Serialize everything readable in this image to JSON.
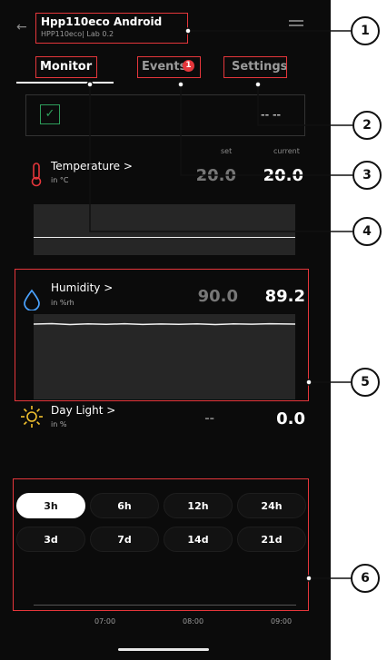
{
  "header": {
    "title": "Hpp110eco Android",
    "subtitle": "HPP110eco| Lab 0.2"
  },
  "tabs": {
    "monitor": "Monitor",
    "events": "Events",
    "events_badge": "1",
    "settings": "Settings"
  },
  "status": {
    "right_value": "-- --"
  },
  "columns": {
    "set": "set",
    "current": "current"
  },
  "temperature": {
    "label": "Temperature >",
    "unit": "in °C",
    "set": "20.0",
    "current": "20.0"
  },
  "humidity": {
    "label": "Humidity >",
    "unit": "in %rh",
    "set": "90.0",
    "current": "89.2"
  },
  "daylight": {
    "label": "Day Light >",
    "unit": "in %",
    "set": "--",
    "current": "0.0"
  },
  "ranges": [
    "3h",
    "6h",
    "12h",
    "24h",
    "3d",
    "7d",
    "14d",
    "21d"
  ],
  "selected_range": "3h",
  "time_axis": [
    "07:00",
    "08:00",
    "09:00"
  ],
  "callouts": [
    "1",
    "2",
    "3",
    "4",
    "5",
    "6"
  ],
  "colors": {
    "accent_red": "#e5363b",
    "check_green": "#2e9e5b",
    "icon_blue": "#4aa3ff",
    "sun_yellow": "#f2c12e"
  }
}
